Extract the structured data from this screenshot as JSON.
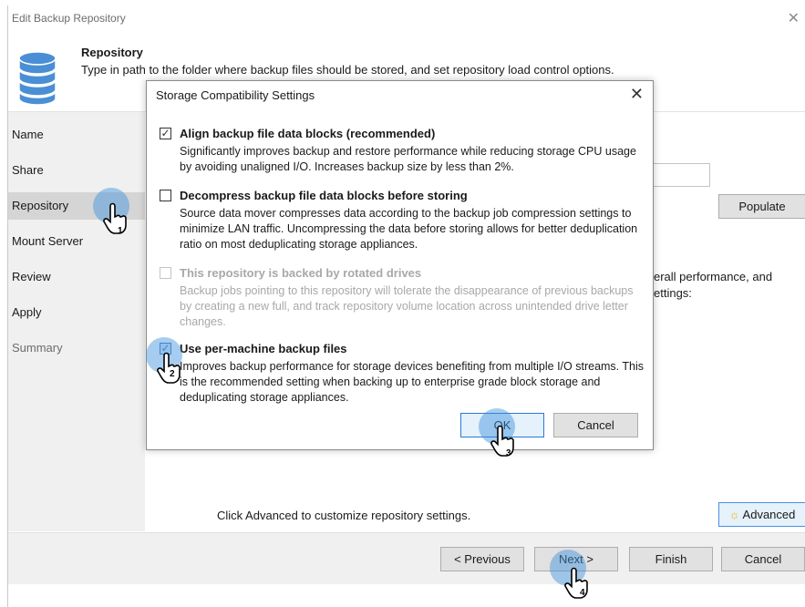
{
  "window": {
    "title": "Edit Backup Repository",
    "close_glyph": "✕"
  },
  "header": {
    "title": "Repository",
    "subtitle": "Type in path to the folder where backup files should be stored, and set repository load control options.",
    "icon": "database-icon"
  },
  "nav": {
    "items": [
      {
        "label": "Name",
        "state": "normal"
      },
      {
        "label": "Share",
        "state": "normal"
      },
      {
        "label": "Repository",
        "state": "active"
      },
      {
        "label": "Mount Server",
        "state": "normal"
      },
      {
        "label": "Review",
        "state": "normal"
      },
      {
        "label": "Apply",
        "state": "normal"
      },
      {
        "label": "Summary",
        "state": "disabled"
      }
    ]
  },
  "main": {
    "populate_label": "Populate",
    "partial_text_1": "erall performance, and",
    "partial_text_2": "ettings:",
    "advanced_hint": "Click Advanced to customize repository settings.",
    "advanced_label": "Advanced"
  },
  "footer": {
    "previous_label": "< Previous",
    "next_label": "Next >",
    "finish_label": "Finish",
    "cancel_label": "Cancel"
  },
  "dialog": {
    "title": "Storage Compatibility Settings",
    "close_glyph": "✕",
    "options": [
      {
        "label": "Align backup file data blocks (recommended)",
        "description": "Significantly improves backup and restore performance while reducing storage CPU usage by avoiding unaligned I/O. Increases backup size by less than 2%.",
        "checked": true,
        "enabled": true
      },
      {
        "label": "Decompress backup file data blocks before storing",
        "description": "Source data mover compresses data according to the backup job compression settings to minimize LAN traffic. Uncompressing the data before storing allows for better deduplication ratio on most deduplicating storage appliances.",
        "checked": false,
        "enabled": true
      },
      {
        "label": "This repository is backed by rotated drives",
        "description": "Backup jobs pointing to this repository will tolerate the disappearance of previous backups by creating a new full, and track repository volume location across unintended drive letter changes.",
        "checked": false,
        "enabled": false
      },
      {
        "label": "Use per-machine backup files",
        "description": "Improves backup performance for storage devices benefiting from multiple I/O streams. This is the recommended setting when backing up to enterprise grade block storage and deduplicating storage appliances.",
        "checked": true,
        "enabled": true
      }
    ],
    "ok_label": "OK",
    "cancel_label": "Cancel"
  },
  "markers": [
    {
      "step": "1"
    },
    {
      "step": "2"
    },
    {
      "step": "3"
    },
    {
      "step": "4"
    }
  ],
  "colors": {
    "accent": "#2b79d6",
    "marker": "#3a90dc",
    "nav_bg": "#f0f0f0",
    "nav_active": "#d5d5d5"
  }
}
